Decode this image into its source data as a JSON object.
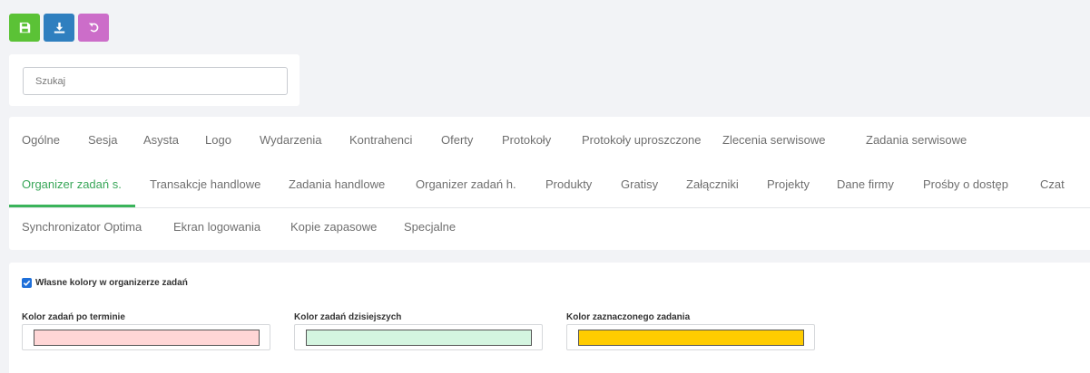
{
  "toolbar": {
    "buttons": [
      {
        "name": "save",
        "icon": "save-icon",
        "color": "#5bc236"
      },
      {
        "name": "download",
        "icon": "download-icon",
        "color": "#2f7fbf"
      },
      {
        "name": "undo",
        "icon": "undo-icon",
        "color": "#cc6dc9"
      }
    ]
  },
  "search": {
    "placeholder": "Szukaj",
    "value": ""
  },
  "tabs": {
    "row1": [
      "Ogólne",
      "Sesja",
      "Asysta",
      "Logo",
      "Wydarzenia",
      "Kontrahenci",
      "Oferty",
      "Protokoły",
      "Protokoły uproszczone",
      "Zlecenia serwisowe",
      "Zadania serwisowe"
    ],
    "row2": [
      "Organizer zadań s.",
      "Transakcje handlowe",
      "Zadania handlowe",
      "Organizer zadań h.",
      "Produkty",
      "Gratisy",
      "Załączniki",
      "Projekty",
      "Dane firmy",
      "Prośby o dostęp",
      "Czat"
    ],
    "row3": [
      "Synchronizator Optima",
      "Ekran logowania",
      "Kopie zapasowe",
      "Specjalne"
    ],
    "active": "Organizer zadań s.",
    "active_color": "#3aa75a"
  },
  "settings": {
    "custom_colors_label": "Własne kolory w organizerze zadań",
    "custom_colors_checked": true,
    "fields": [
      {
        "label": "Kolor zadań po terminie",
        "color": "#ffd6d6"
      },
      {
        "label": "Kolor zadań dzisiejszych",
        "color": "#d4f5e0"
      },
      {
        "label": "Kolor zaznaczonego zadania",
        "color": "#ffcc00"
      }
    ]
  }
}
